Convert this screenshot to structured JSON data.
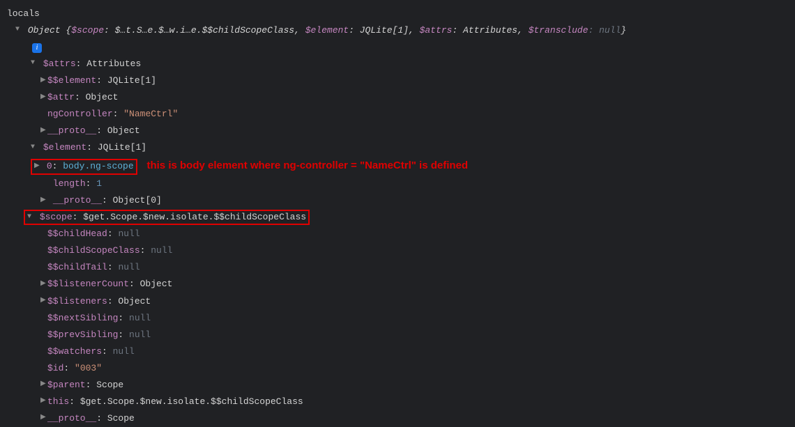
{
  "header": "locals",
  "objectSummary": {
    "prefix": "Object {",
    "k1": "$scope",
    "v1": ": $…t.S…e.$…w.i…e.$$childScopeClass, ",
    "k2": "$element",
    "v2": ": JQLite[1], ",
    "k3": "$attrs",
    "v3": ": Attributes, ",
    "k4": "$transclude",
    "v4": ": null",
    "suffix": "}"
  },
  "info": "i",
  "attrs": {
    "key": "$attrs",
    "val": ": Attributes"
  },
  "attrs_children": [
    {
      "arrow": "right",
      "key": "$$element",
      "val": ": JQLite[1]"
    },
    {
      "arrow": "right",
      "key": "$attr",
      "val": ": Object"
    },
    {
      "arrow": "none",
      "key": "ngController",
      "valPrefix": ": ",
      "str": "\"NameCtrl\""
    },
    {
      "arrow": "right",
      "key": "__proto__",
      "val": ": Object"
    }
  ],
  "element": {
    "key": "$element",
    "val": ": JQLite[1]"
  },
  "element_row0": {
    "arrow": "right",
    "key": "0",
    "sep": ": ",
    "tag": "body",
    "cls": ".ng-scope",
    "annotation": "this is body element where ng-controller = \"NameCtrl\" is defined"
  },
  "element_length": {
    "key": "length",
    "sep": ": ",
    "num": "1"
  },
  "element_proto": {
    "arrow": "right",
    "key": "__proto__",
    "val": ": Object[0]"
  },
  "scope_header": {
    "key": "$scope",
    "val": ": $get.Scope.$new.isolate.$$childScopeClass"
  },
  "scope_children": [
    {
      "arrow": "none",
      "key": "$$childHead",
      "valPrefix": ": ",
      "dim": "null"
    },
    {
      "arrow": "none",
      "key": "$$childScopeClass",
      "valPrefix": ": ",
      "dim": "null"
    },
    {
      "arrow": "none",
      "key": "$$childTail",
      "valPrefix": ": ",
      "dim": "null"
    },
    {
      "arrow": "right",
      "key": "$$listenerCount",
      "val": ": Object"
    },
    {
      "arrow": "right",
      "key": "$$listeners",
      "val": ": Object"
    },
    {
      "arrow": "none",
      "key": "$$nextSibling",
      "valPrefix": ": ",
      "dim": "null"
    },
    {
      "arrow": "none",
      "key": "$$prevSibling",
      "valPrefix": ": ",
      "dim": "null"
    },
    {
      "arrow": "none",
      "key": "$$watchers",
      "valPrefix": ": ",
      "dim": "null"
    },
    {
      "arrow": "none",
      "key": "$id",
      "valPrefix": ": ",
      "str": "\"003\""
    },
    {
      "arrow": "right",
      "key": "$parent",
      "val": ": Scope"
    },
    {
      "arrow": "right",
      "key": "this",
      "val": ": $get.Scope.$new.isolate.$$childScopeClass"
    },
    {
      "arrow": "right",
      "key": "__proto__",
      "val": ": Scope"
    }
  ]
}
